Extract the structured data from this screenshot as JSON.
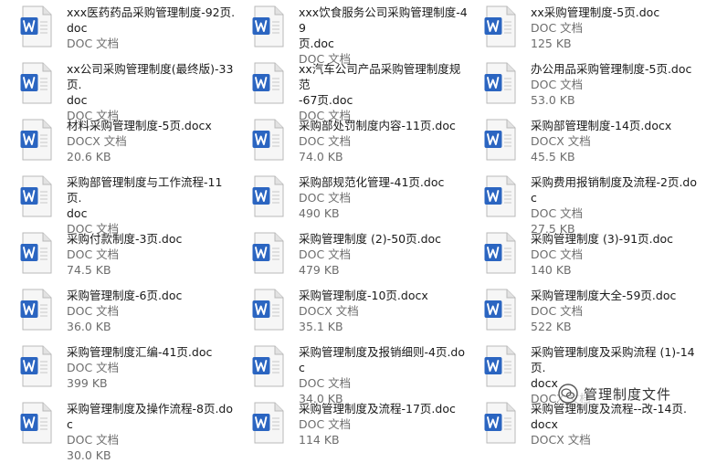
{
  "files": [
    {
      "name": "xxx医药药品采购管理制度-92页.\ndoc",
      "type": "DOC 文档",
      "size": "",
      "icon": "word-doc-icon"
    },
    {
      "name": "xxx饮食服务公司采购管理制度-49\n页.doc",
      "type": "DOC 文档",
      "size": "",
      "icon": "word-doc-icon"
    },
    {
      "name": "xx采购管理制度-5页.doc",
      "type": "DOC 文档",
      "size": "125 KB",
      "icon": "word-doc-icon"
    },
    {
      "name": "xx公司采购管理制度(最终版)-33页.\ndoc",
      "type": "DOC 文档",
      "size": "",
      "icon": "word-doc-icon"
    },
    {
      "name": "xx汽车公司产品采购管理制度规范\n-67页.doc",
      "type": "DOC 文档",
      "size": "",
      "icon": "word-doc-icon"
    },
    {
      "name": "办公用品采购管理制度-5页.doc",
      "type": "DOC 文档",
      "size": "53.0 KB",
      "icon": "word-doc-icon"
    },
    {
      "name": "材料采购管理制度-5页.docx",
      "type": "DOCX 文档",
      "size": "20.6 KB",
      "icon": "word-docx-icon"
    },
    {
      "name": "采购部处罚制度内容-11页.doc",
      "type": "DOC 文档",
      "size": "74.0 KB",
      "icon": "word-doc-icon"
    },
    {
      "name": "采购部管理制度-14页.docx",
      "type": "DOCX 文档",
      "size": "45.5 KB",
      "icon": "word-docx-icon"
    },
    {
      "name": "采购部管理制度与工作流程-11页.\ndoc",
      "type": "DOC 文档",
      "size": "",
      "icon": "word-doc-icon"
    },
    {
      "name": "采购部规范化管理-41页.doc",
      "type": "DOC 文档",
      "size": "490 KB",
      "icon": "word-doc-icon"
    },
    {
      "name": "采购费用报销制度及流程-2页.doc",
      "type": "DOC 文档",
      "size": "27.5 KB",
      "icon": "word-doc-icon"
    },
    {
      "name": "采购付款制度-3页.doc",
      "type": "DOC 文档",
      "size": "74.5 KB",
      "icon": "word-doc-icon"
    },
    {
      "name": "采购管理制度 (2)-50页.doc",
      "type": "DOC 文档",
      "size": "479 KB",
      "icon": "word-doc-icon"
    },
    {
      "name": "采购管理制度 (3)-91页.doc",
      "type": "DOC 文档",
      "size": "140 KB",
      "icon": "word-doc-icon"
    },
    {
      "name": "采购管理制度-6页.doc",
      "type": "DOC 文档",
      "size": "36.0 KB",
      "icon": "word-doc-icon"
    },
    {
      "name": "采购管理制度-10页.docx",
      "type": "DOCX 文档",
      "size": "35.1 KB",
      "icon": "word-docx-icon"
    },
    {
      "name": "采购管理制度大全-59页.doc",
      "type": "DOC 文档",
      "size": "522 KB",
      "icon": "word-doc-icon"
    },
    {
      "name": "采购管理制度汇编-41页.doc",
      "type": "DOC 文档",
      "size": "399 KB",
      "icon": "word-doc-icon"
    },
    {
      "name": "采购管理制度及报销细则-4页.doc",
      "type": "DOC 文档",
      "size": "34.0 KB",
      "icon": "word-doc-icon"
    },
    {
      "name": "采购管理制度及采购流程 (1)-14页.\ndocx",
      "type": "DOCX 文档",
      "size": "",
      "icon": "word-docx-icon"
    },
    {
      "name": "采购管理制度及操作流程-8页.doc",
      "type": "DOC 文档",
      "size": "30.0 KB",
      "icon": "word-doc-icon"
    },
    {
      "name": "采购管理制度及流程-17页.doc",
      "type": "DOC 文档",
      "size": "114 KB",
      "icon": "word-doc-icon"
    },
    {
      "name": "采购管理制度及流程--改-14页.\ndocx",
      "type": "DOCX 文档",
      "size": "",
      "icon": "word-docx-icon"
    }
  ],
  "watermark": {
    "text": "管理制度文件",
    "icon": "wechat-logo-icon"
  },
  "colors": {
    "doc_badge": "#2b65c1",
    "docx_badge": "#2b65c1",
    "page": "#f6f6f6",
    "page_border": "#b9b9b9"
  }
}
